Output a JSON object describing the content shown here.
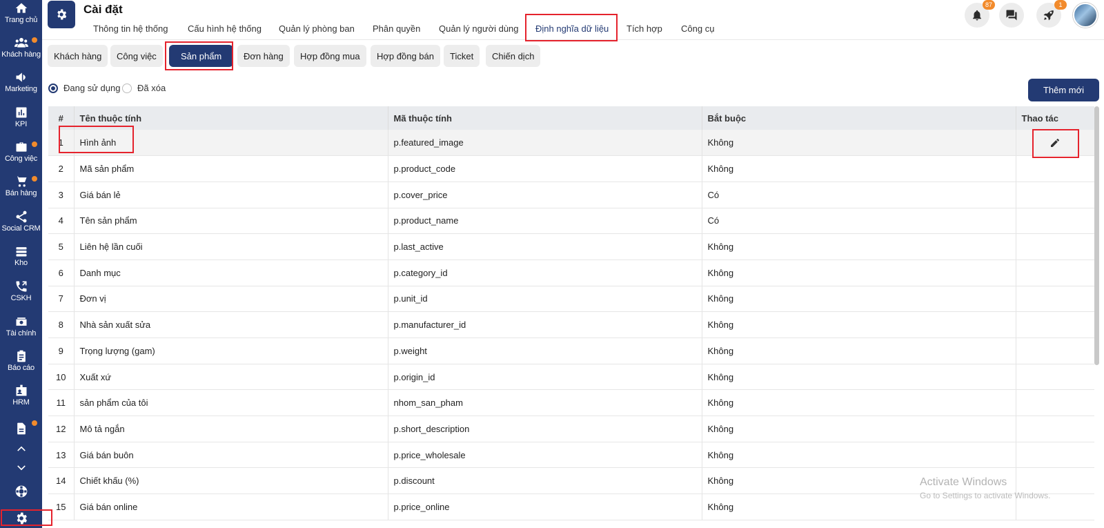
{
  "sidebar": {
    "items": [
      {
        "label": "Trang chủ",
        "icon": "home-icon"
      },
      {
        "label": "Khách hàng",
        "icon": "users-icon",
        "dot": true
      },
      {
        "label": "Marketing",
        "icon": "megaphone-icon"
      },
      {
        "label": "KPI",
        "icon": "chart-icon"
      },
      {
        "label": "Công việc",
        "icon": "briefcase-icon",
        "dot": true
      },
      {
        "label": "Bán hàng",
        "icon": "cart-icon",
        "dot": true
      },
      {
        "label": "Social CRM",
        "icon": "share-icon"
      },
      {
        "label": "Kho",
        "icon": "stack-icon"
      },
      {
        "label": "CSKH",
        "icon": "phone-icon"
      },
      {
        "label": "Tài chính",
        "icon": "money-icon"
      },
      {
        "label": "Báo cáo",
        "icon": "clipboard-icon"
      },
      {
        "label": "HRM",
        "icon": "badge-icon"
      }
    ]
  },
  "header": {
    "title": "Cài đặt",
    "tabs": [
      {
        "label": "Thông tin hệ thống"
      },
      {
        "label": "Cấu hình hệ thống"
      },
      {
        "label": "Quản lý phòng ban"
      },
      {
        "label": "Phân quyền"
      },
      {
        "label": "Quản lý người dùng"
      },
      {
        "label": "Định nghĩa dữ liệu",
        "active": true
      },
      {
        "label": "Tích hợp"
      },
      {
        "label": "Công cụ"
      }
    ],
    "notifications_count": "87",
    "rocket_count": "1"
  },
  "subtabs": [
    {
      "label": "Khách hàng"
    },
    {
      "label": "Công việc"
    },
    {
      "label": "Sản phẩm",
      "active": true
    },
    {
      "label": "Đơn hàng"
    },
    {
      "label": "Hợp đồng mua"
    },
    {
      "label": "Hợp đồng bán"
    },
    {
      "label": "Ticket"
    },
    {
      "label": "Chiến dịch"
    }
  ],
  "filter": {
    "in_use_label": "Đang sử dụng",
    "deleted_label": "Đã xóa",
    "selected": "in_use"
  },
  "add_button_label": "Thêm mới",
  "table": {
    "headers": {
      "index": "#",
      "name": "Tên thuộc tính",
      "code": "Mã thuộc tính",
      "required": "Bắt buộc",
      "actions": "Thao tác"
    },
    "rows": [
      {
        "index": "1",
        "name": "Hình ảnh",
        "code": "p.featured_image",
        "required": "Không"
      },
      {
        "index": "2",
        "name": "Mã sản phẩm",
        "code": "p.product_code",
        "required": "Không"
      },
      {
        "index": "3",
        "name": "Giá bán lẻ",
        "code": "p.cover_price",
        "required": "Có"
      },
      {
        "index": "4",
        "name": "Tên sản phẩm",
        "code": "p.product_name",
        "required": "Có"
      },
      {
        "index": "5",
        "name": "Liên hệ lần cuối",
        "code": "p.last_active",
        "required": "Không"
      },
      {
        "index": "6",
        "name": "Danh mục",
        "code": "p.category_id",
        "required": "Không"
      },
      {
        "index": "7",
        "name": "Đơn vị",
        "code": "p.unit_id",
        "required": "Không"
      },
      {
        "index": "8",
        "name": "Nhà sản xuất sửa",
        "code": "p.manufacturer_id",
        "required": "Không"
      },
      {
        "index": "9",
        "name": "Trọng lượng (gam)",
        "code": "p.weight",
        "required": "Không"
      },
      {
        "index": "10",
        "name": "Xuất xứ",
        "code": "p.origin_id",
        "required": "Không"
      },
      {
        "index": "11",
        "name": "sản phẩm của tôi",
        "code": "nhom_san_pham",
        "required": "Không"
      },
      {
        "index": "12",
        "name": "Mô tả ngắn",
        "code": "p.short_description",
        "required": "Không"
      },
      {
        "index": "13",
        "name": "Giá bán buôn",
        "code": "p.price_wholesale",
        "required": "Không"
      },
      {
        "index": "14",
        "name": "Chiết khấu (%)",
        "code": "p.discount",
        "required": "Không"
      },
      {
        "index": "15",
        "name": "Giá bán online",
        "code": "p.price_online",
        "required": "Không"
      }
    ]
  },
  "watermark": {
    "line1": "Activate Windows",
    "line2": "Go to Settings to activate Windows."
  },
  "colors": {
    "primary": "#233a73",
    "accent": "#f28b2c",
    "highlight": "#e5222c"
  }
}
